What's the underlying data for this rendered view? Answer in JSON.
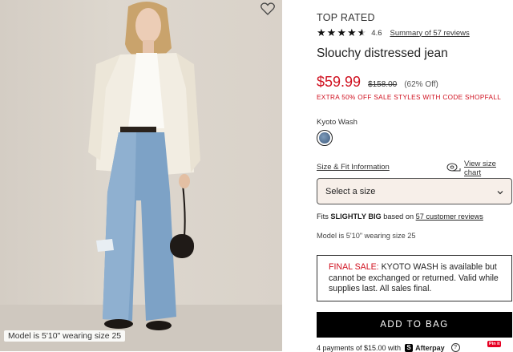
{
  "gallery": {
    "caption": "Model is 5'10\" wearing size 25"
  },
  "product": {
    "badge": "TOP RATED",
    "rating_value": "4.6",
    "rating_stars": 4.6,
    "reviews_link": "Summary of 57 reviews",
    "title": "Slouchy distressed jean",
    "sale_price": "$59.99",
    "original_price": "$158.00",
    "discount": "(62% Off)",
    "promo": "EXTRA 50% OFF SALE STYLES WITH CODE SHOPFALL"
  },
  "color": {
    "name": "Kyoto Wash"
  },
  "size": {
    "fit_info_link": "Size & Fit Information",
    "chart_link": "View size chart",
    "select_label": "Select a size",
    "fits_prefix": "Fits",
    "fits_value": "SLIGHTLY BIG",
    "fits_middle": "based on",
    "fits_link": "57 customer reviews",
    "model_info": "Model is 5'10\" wearing size 25"
  },
  "final_sale": {
    "label": "FINAL SALE:",
    "text": "KYOTO WASH is available but cannot be exchanged or returned. Valid while supplies last. All sales final."
  },
  "cart": {
    "add_label": "ADD TO BAG",
    "payments_text": "4 payments of $15.00 with",
    "afterpay": "Afterpay",
    "pin_label": "Pin it"
  },
  "colors": {
    "sale_red": "#d0101f",
    "button_black": "#000000",
    "select_bg": "#f7efe9"
  }
}
